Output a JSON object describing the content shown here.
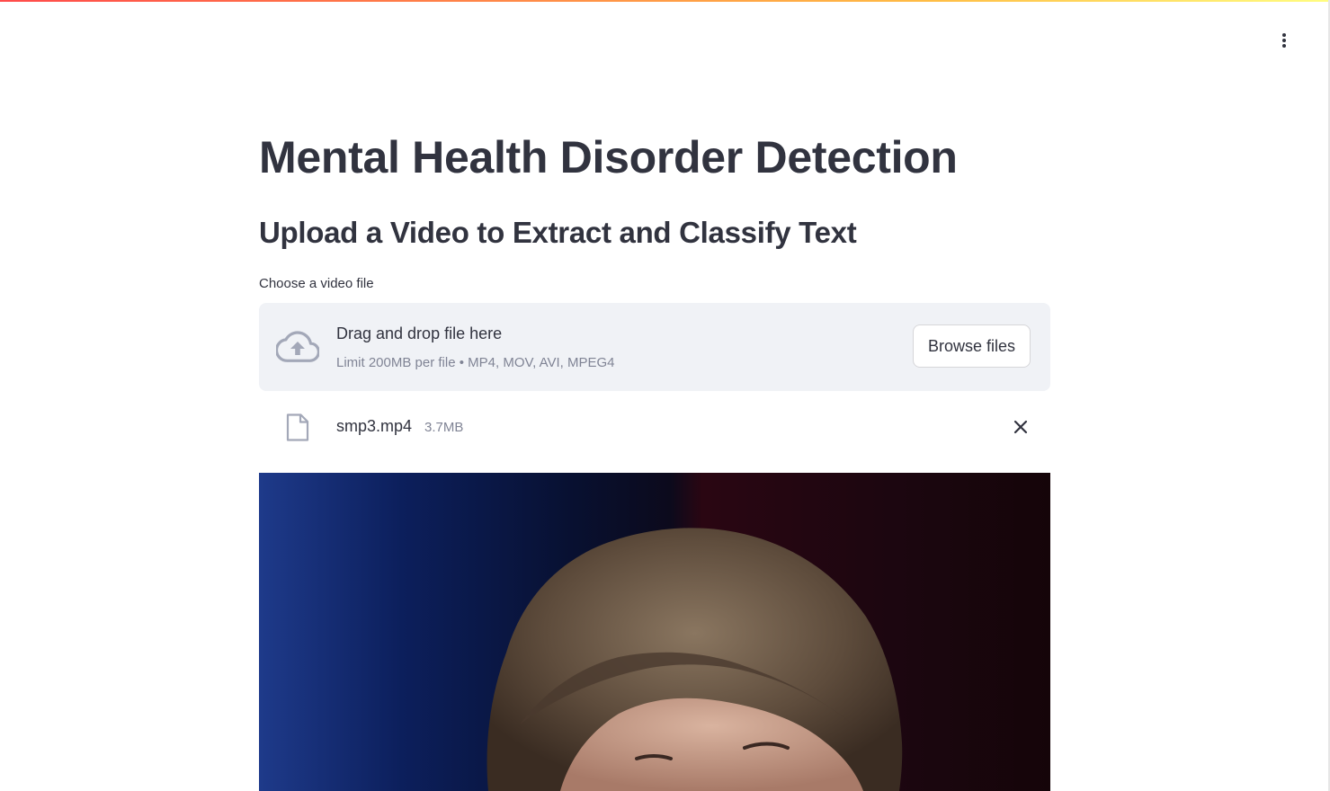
{
  "header": {
    "menu_icon": "vertical-ellipsis-icon"
  },
  "main": {
    "title": "Mental Health Disorder Detection",
    "subtitle": "Upload a Video to Extract and Classify Text"
  },
  "uploader": {
    "label": "Choose a video file",
    "drop_text": "Drag and drop file here",
    "limit_text": "Limit 200MB per file • MP4, MOV, AVI, MPEG4",
    "browse_label": "Browse files",
    "upload_icon": "cloud-upload-icon"
  },
  "uploaded_file": {
    "name": "smp3.mp4",
    "size": "3.7MB",
    "file_icon": "file-icon",
    "remove_icon": "close-icon"
  },
  "video": {
    "content": "video-frame-person"
  },
  "colors": {
    "text": "#31333f",
    "muted": "#808495",
    "dropzone_bg": "#f0f2f6",
    "accent_start": "#ff4b4b",
    "accent_end": "#fffd80"
  }
}
